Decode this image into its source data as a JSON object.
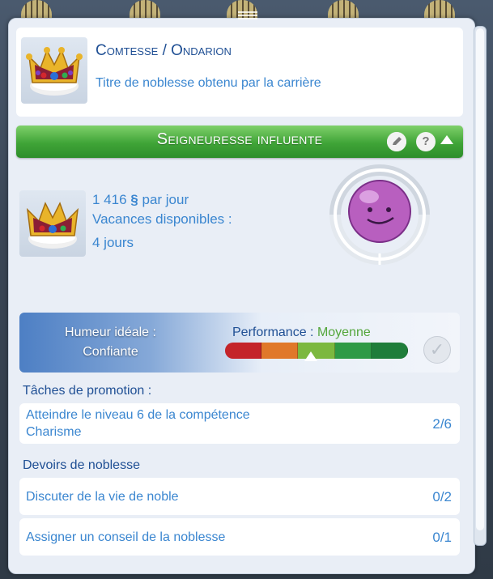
{
  "title_card": {
    "name": "Comtesse / Ondarion",
    "description": "Titre de noblesse obtenu par la carrière"
  },
  "career": {
    "title": "Seigneuresse influente",
    "edit_icon": "pencil-icon",
    "help_label": "?",
    "collapse_icon": "chevron-up-icon",
    "pay_amount": "1 416",
    "currency_symbol": "§",
    "pay_suffix": "par jour",
    "vacation_label": "Vacances disponibles :",
    "vacation_value": "4 jours"
  },
  "performance": {
    "ideal_mood_label": "Humeur idéale :",
    "ideal_mood_value": "Confiante",
    "label": "Performance :",
    "level": "Moyenne",
    "level_fraction": 0.47,
    "segment_colors": [
      "#c4242a",
      "#e0782a",
      "#7cb83f",
      "#2f9a46",
      "#1f7d3a"
    ],
    "check_icon": "checkmark-icon"
  },
  "promotion": {
    "heading": "Tâches de promotion :",
    "tasks": [
      {
        "label_line1": "Atteindre le niveau 6 de la compétence",
        "label_line2": "Charisme",
        "count": "2/6"
      }
    ]
  },
  "noble_duties": {
    "heading": "Devoirs de noblesse",
    "tasks": [
      {
        "label": "Discuter de la vie de noble",
        "count": "0/2"
      },
      {
        "label": "Assigner un conseil de la noblesse",
        "count": "0/1"
      }
    ]
  },
  "colors": {
    "career_green": "#3fa437",
    "primary_blue": "#1f4f94",
    "link_blue": "#3a86d0",
    "moodlet_purple": "#b85fbf"
  }
}
